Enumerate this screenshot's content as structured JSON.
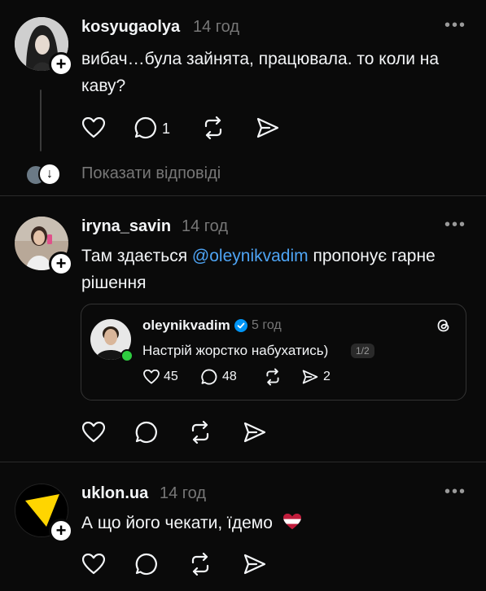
{
  "posts": [
    {
      "username": "kosyugaolya",
      "time": "14 год",
      "text": "вибач…була зайнята, працювала. то коли на каву?",
      "reply_count": "1",
      "show_replies": "Показати відповіді"
    },
    {
      "username": "iryna_savin",
      "time": "14 год",
      "text_before": "Там здається ",
      "mention": "@oleynikvadim",
      "text_after": " пропонує гарне рішення",
      "quoted": {
        "username": "oleynikvadim",
        "time": "5 год",
        "text": "Настрій жорстко набухатись)",
        "pager": "1/2",
        "likes": "45",
        "comments": "48",
        "shares": "2"
      }
    },
    {
      "username": "uklon.ua",
      "time": "14 год",
      "text": "А що його чекати, їдемо"
    }
  ],
  "colors": {
    "background": "#0a0a0a",
    "mention": "#4ea4f4",
    "secondary_text": "#777777",
    "uklon_brand": "#ffd500"
  }
}
